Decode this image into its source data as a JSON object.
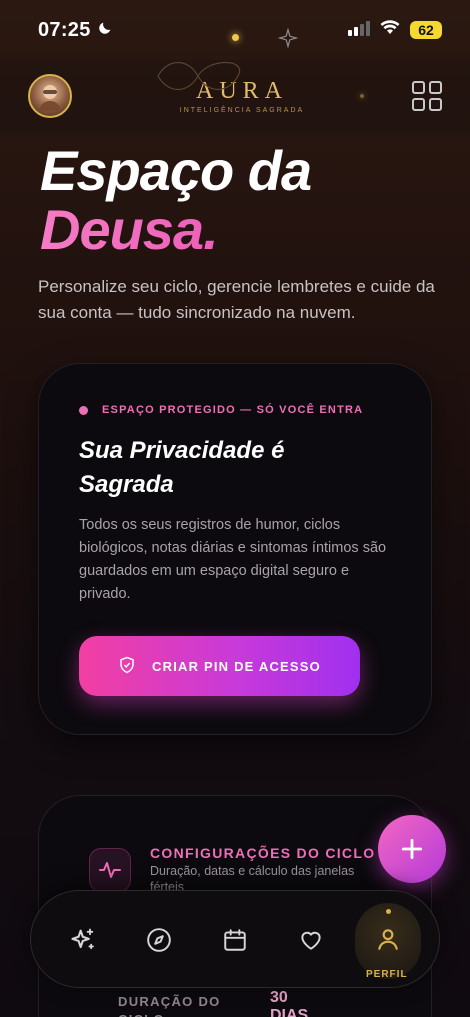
{
  "status_bar": {
    "time": "07:25",
    "battery": "62"
  },
  "header": {
    "logo_title": "AURA",
    "logo_subtitle": "INTELIGÊNCIA SAGRADA"
  },
  "hero": {
    "title_line1": "Espaço da",
    "title_line2": "Deusa.",
    "description": "Personalize seu ciclo, gerencie lembretes e cuide da sua conta — tudo sincronizado na nuvem."
  },
  "privacy_card": {
    "tag": "ESPAÇO PROTEGIDO — SÓ VOCÊ ENTRA",
    "title": "Sua Privacidade é Sagrada",
    "text": "Todos os seus registros de humor, ciclos biológicos, notas diárias e sintomas íntimos são guardados em um espaço digital seguro e privado.",
    "button_label": "CRIAR PIN DE ACESSO"
  },
  "cycle_card": {
    "title": "CONFIGURAÇÕES DO CICLO",
    "subtitle": "Duração, datas e cálculo das janelas férteis",
    "duration_label": "DURAÇÃO DO CICLO",
    "duration_value": "30 DIAS"
  },
  "bottom_nav": {
    "active_label": "PERFIL"
  },
  "colors": {
    "accent_pink": "#ef6fb7",
    "gold": "#d8b24a",
    "button_gradient_start": "#f23fa2",
    "button_gradient_end": "#a030ef"
  },
  "icons": [
    "moon-icon",
    "signal-icon",
    "wifi-icon",
    "grid-icon",
    "sparkle-icon",
    "shield-icon",
    "pulse-icon",
    "plus-icon",
    "compass-icon",
    "calendar-icon",
    "heart-icon",
    "user-icon"
  ]
}
